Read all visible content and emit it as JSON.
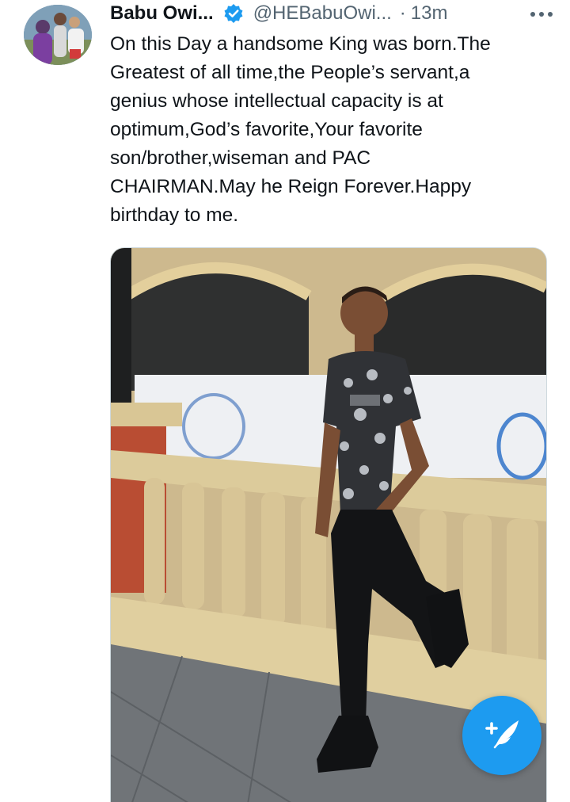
{
  "tweet": {
    "display_name": "Babu Owi...",
    "handle": "@HEBabuOwi...",
    "separator": "·",
    "time": "13m",
    "verified": true,
    "text_lines": [
      "On this Day a handsome King was born.The",
      "Greatest of all time,the People’s servant,a",
      "genius whose intellectual capacity is at",
      "optimum,God’s favorite,Your favorite",
      "son/brother,wiseman and PAC",
      "CHAIRMAN.May he Reign Forever.Happy",
      "birthday to me."
    ]
  },
  "icons": {
    "verified": "verified-badge-icon",
    "more": "more-options-icon",
    "compose": "compose-tweet-icon"
  },
  "colors": {
    "accent": "#1d9bf0",
    "text_primary": "#0f1419",
    "text_secondary": "#536471"
  }
}
